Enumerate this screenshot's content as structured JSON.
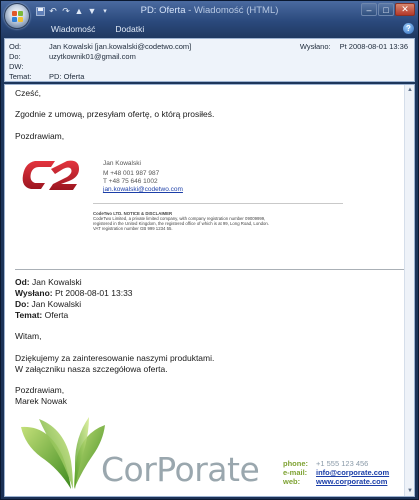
{
  "window": {
    "subject": "PD: Oferta",
    "app_name": "Wiadomość (HTML)",
    "separator": " - "
  },
  "ribbon": {
    "tabs": [
      "Wiadomość",
      "Dodatki"
    ]
  },
  "header": {
    "from_label": "Od:",
    "from_value": "Jan Kowalski [jan.kowalski@codetwo.com]",
    "to_label": "Do:",
    "to_value": "uzytkownik01@gmail.com",
    "cc_label": "DW:",
    "cc_value": "",
    "subject_label": "Temat:",
    "subject_value": "PD: Oferta",
    "sent_label": "Wysłano:",
    "sent_value": "Pt 2008-08-01 13:36"
  },
  "message": {
    "greeting": "Cześć,",
    "line1": "Zgodnie z umową, przesyłam ofertę, o którą prosiłeś.",
    "closing": "Pozdrawiam,",
    "signature": {
      "name": "Jan Kowalski",
      "mobile": "M    +48 001 987 987",
      "phone": "T    +48 75 646 1002",
      "email": "jan.kowalski@codetwo.com"
    },
    "disclaimer": {
      "title": "CodeTwo LTD. NOTICE & DISCLAIMER",
      "line1": "CodeTwo Limited, a private limited company, with company registration number 09009999,",
      "line2": "registered in the United Kingdom, the registered office of which is at 99, Long Road, London.",
      "line3": "VAT registration number GB 999 1234 55."
    }
  },
  "forwarded": {
    "from_label": "Od:",
    "from_value": "Jan Kowalski",
    "sent_label": "Wysłano:",
    "sent_value": "Pt 2008-08-01 13:33",
    "to_label": "Do:",
    "to_value": "Jan Kowalski",
    "subject_label": "Temat:",
    "subject_value": "Oferta",
    "greeting": "Witam,",
    "line1": "Dziękujemy za zainteresowanie naszymi produktami.",
    "line2": "W załączniku nasza szczegółowa oferta.",
    "closing": "Pozdrawiam,",
    "signer": "Marek Nowak"
  },
  "corporate": {
    "logo_text": "CorPorate",
    "phone_label": "phone:",
    "phone_value": "+1 555 123 456",
    "email_label": "e-mail:",
    "email_value": "info@corporate.com",
    "web_label": "web:",
    "web_value": "www.corporate.com"
  },
  "colors": {
    "logo_red": "#c8202c",
    "leaf_green": "#7cb52a",
    "corporate_text": "#9aa7ae",
    "link_blue": "#1b3ea8"
  }
}
